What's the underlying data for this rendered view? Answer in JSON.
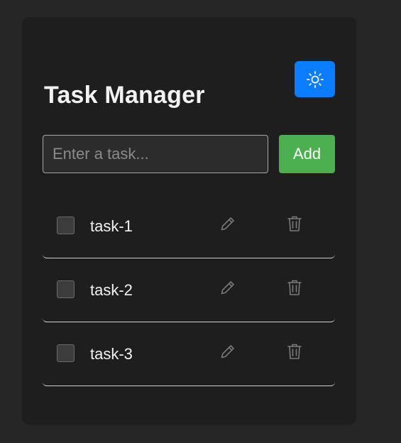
{
  "app": {
    "title": "Task Manager"
  },
  "header": {
    "theme_toggle": {
      "icon": "sun-icon",
      "color": "#0a7cff"
    }
  },
  "input": {
    "placeholder": "Enter a task...",
    "value": ""
  },
  "add_button": {
    "label": "Add",
    "color": "#4caf50"
  },
  "tasks": [
    {
      "label": "task-1",
      "checked": false,
      "edit_icon": "pencil-icon",
      "delete_icon": "trash-icon"
    },
    {
      "label": "task-2",
      "checked": false,
      "edit_icon": "pencil-icon",
      "delete_icon": "trash-icon"
    },
    {
      "label": "task-3",
      "checked": false,
      "edit_icon": "pencil-icon",
      "delete_icon": "trash-icon"
    }
  ]
}
